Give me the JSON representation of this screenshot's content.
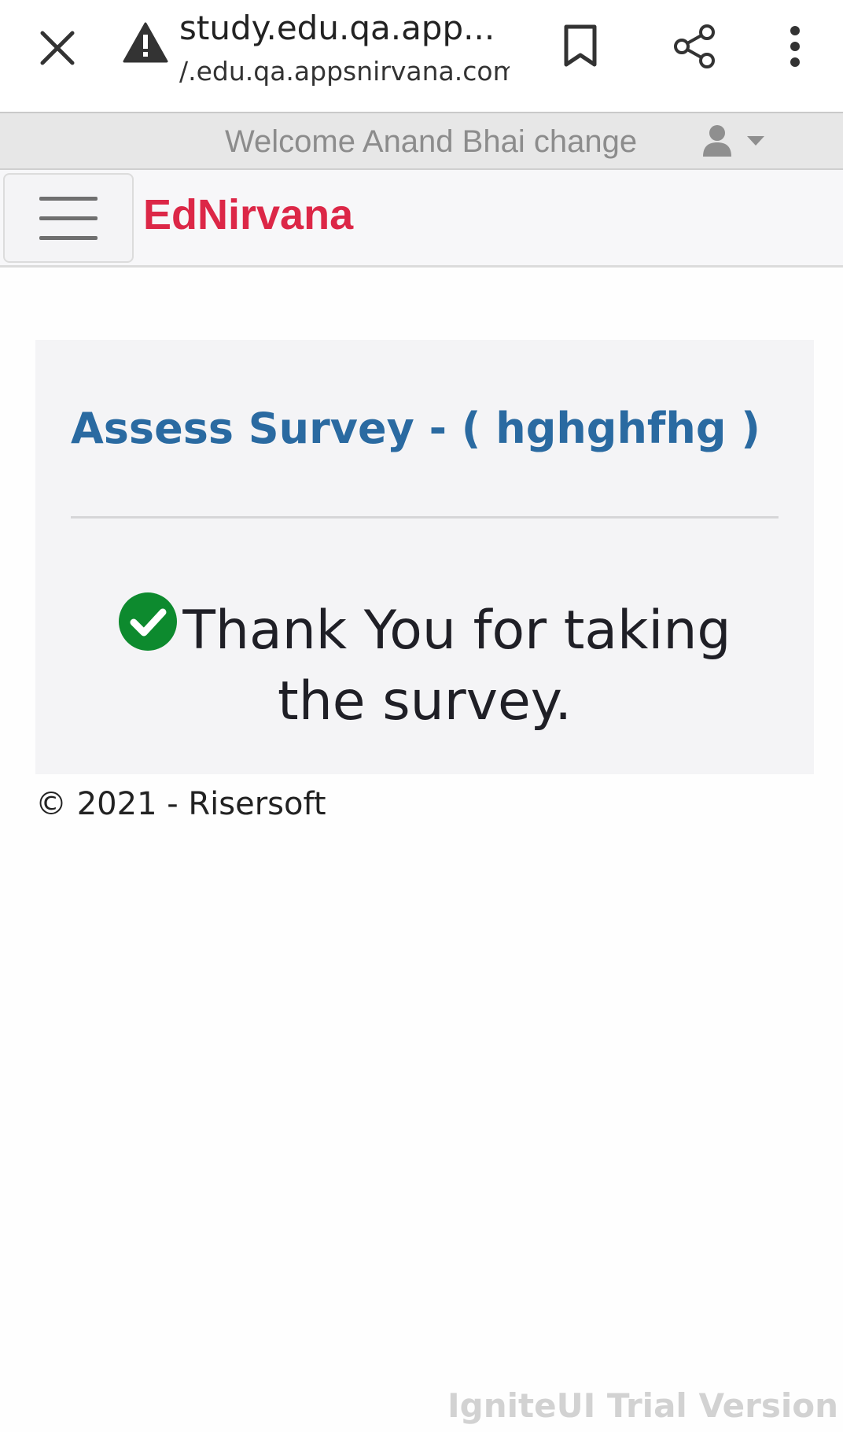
{
  "browser": {
    "url_title": "study.edu.qa.app...",
    "url_subtitle": "/.edu.qa.appsnirvana.com",
    "icons": [
      "close-icon",
      "warning-icon",
      "bookmark-icon",
      "share-icon",
      "more-vert-icon"
    ]
  },
  "welcome_bar": {
    "text": "Welcome Anand Bhai change",
    "user_icon": "user-icon",
    "caret_icon": "caret-down-icon"
  },
  "navbar": {
    "menu_icon": "hamburger-icon",
    "brand": "EdNirvana",
    "brand_color": "#dc2747"
  },
  "survey": {
    "title": "Assess Survey - ( hghghfhg )",
    "title_color": "#2a6aa1",
    "message": "Thank You for taking the survey.",
    "status_icon": "check-circle-icon",
    "status_color": "#0d8a2e"
  },
  "footer": {
    "text": "© 2021 - Risersoft"
  },
  "watermark": {
    "text": "IgniteUI Trial Version"
  }
}
